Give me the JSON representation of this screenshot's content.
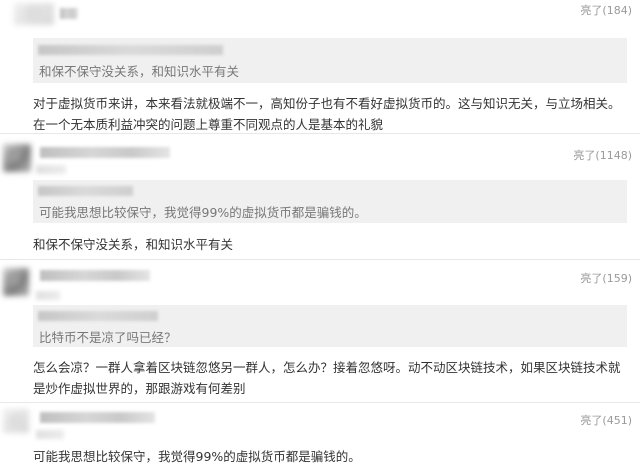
{
  "comments": [
    {
      "likes_label": "亮了(184)",
      "quote_text": "和保不保守没关系，和知识水平有关",
      "body": "对于虚拟货币来讲，本来看法就极端不一，高知份子也有不看好虚拟货币的。这与知识无关，与立场相关。在一个无本质利益冲突的问题上尊重不同观点的人是基本的礼貌"
    },
    {
      "likes_label": "亮了(1148)",
      "quote_text": "可能我思想比较保守，我觉得99%的虚拟货币都是骗钱的。",
      "body": "和保不保守没关系，和知识水平有关"
    },
    {
      "likes_label": "亮了(159)",
      "quote_text": "比特币不是凉了吗已经？",
      "body": "怎么会凉？一群人拿着区块链忽悠另一群人，怎么办？接着忽悠呀。动不动区块链技术，如果区块链技术就是炒作虚拟世界的，那跟游戏有何差别"
    },
    {
      "likes_label": "亮了(451)",
      "body": "可能我思想比较保守，我觉得99%的虚拟货币都是骗钱的。"
    }
  ]
}
